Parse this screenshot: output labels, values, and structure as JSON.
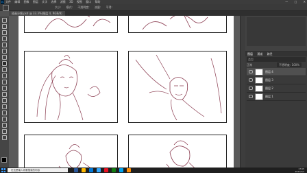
{
  "app": {
    "logo_text": "Ps"
  },
  "menubar": {
    "items": [
      "文件",
      "编辑",
      "图像",
      "图层",
      "文字",
      "选择",
      "滤镜",
      "3D",
      "视图",
      "窗口",
      "帮助"
    ],
    "window_controls": [
      "—",
      "□",
      "✕"
    ]
  },
  "options": {
    "items": [
      "大小:",
      "模式:",
      "不透明度:",
      "流量:",
      "平滑:"
    ]
  },
  "document": {
    "tab_label": "插画分镜.psd @ 33.3%(图层 4, RGB/8)"
  },
  "tools": [
    "move-tool",
    "marquee-tool",
    "lasso-tool",
    "quick-select-tool",
    "crop-tool",
    "eyedropper-tool",
    "healing-tool",
    "brush-tool",
    "stamp-tool",
    "history-brush-tool",
    "eraser-tool",
    "gradient-tool",
    "blur-tool",
    "dodge-tool",
    "pen-tool",
    "type-tool",
    "path-select-tool",
    "shape-tool",
    "hand-tool",
    "zoom-tool"
  ],
  "colors": {
    "foreground": "#000000",
    "background": "#ffffff",
    "sketch_line": "#8a3b4f"
  },
  "layers_panel": {
    "tabs": [
      "图层",
      "通道",
      "路径"
    ],
    "filter_label": "类型",
    "blend_mode": "正常",
    "opacity_label": "不透明度: 100%",
    "layers": [
      {
        "name": "图层 4",
        "selected": true
      },
      {
        "name": "图层 3",
        "selected": false
      },
      {
        "name": "图层 2",
        "selected": false
      },
      {
        "name": "图层 1",
        "selected": false
      }
    ]
  },
  "taskbar": {
    "search_placeholder": "在这里输入你要搜索的内容",
    "app_colors": [
      "#2b579a",
      "#ffb900",
      "#0078d7",
      "#31a8ff",
      "#e81123",
      "#107c10",
      "#00a4ef",
      "#ff8c00"
    ],
    "time": "17:05",
    "date": "2021/4/2"
  }
}
